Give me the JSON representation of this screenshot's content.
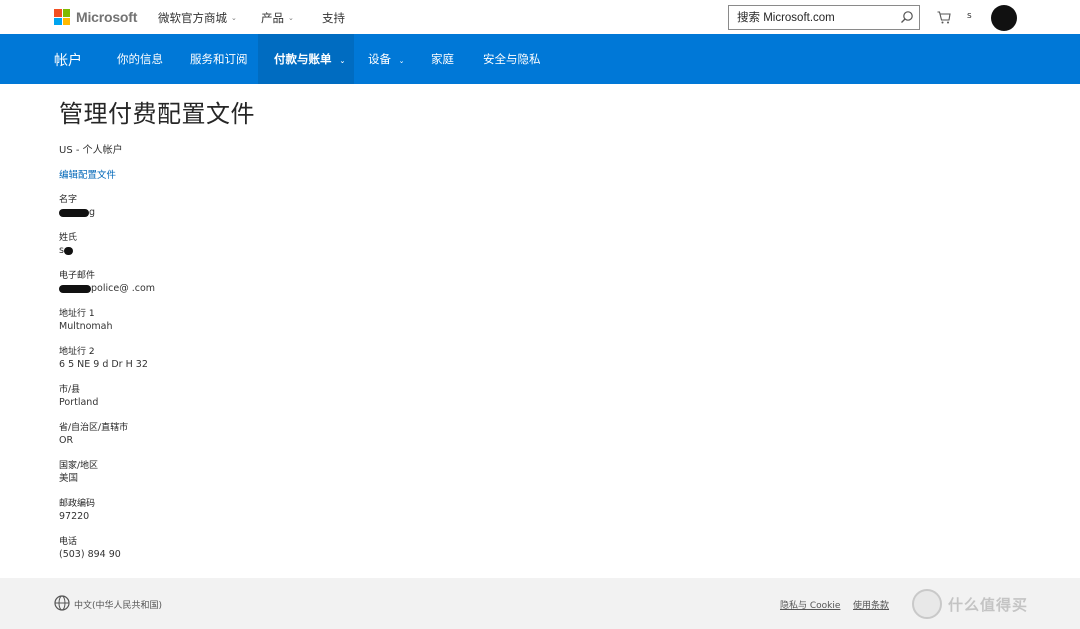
{
  "header": {
    "logo_text": "Microsoft",
    "logo_colors": [
      "#f25022",
      "#7fba00",
      "#00a4ef",
      "#ffb900"
    ],
    "nav": [
      {
        "label": "微软官方商城",
        "has_dropdown": true
      },
      {
        "label": "产品",
        "has_dropdown": true
      },
      {
        "label": "支持",
        "has_dropdown": false
      }
    ],
    "search_placeholder": "搜索 Microsoft.com",
    "user_initial": "s"
  },
  "account_nav": {
    "brand": "帐户",
    "items": [
      {
        "label": "你的信息",
        "has_dropdown": false,
        "active": false
      },
      {
        "label": "服务和订阅",
        "has_dropdown": false,
        "active": false
      },
      {
        "label": "付款与账单",
        "has_dropdown": true,
        "active": true
      },
      {
        "label": "设备",
        "has_dropdown": true,
        "active": false
      },
      {
        "label": "家庭",
        "has_dropdown": false,
        "active": false
      },
      {
        "label": "安全与隐私",
        "has_dropdown": false,
        "active": false
      }
    ],
    "color": "#0078d7"
  },
  "main": {
    "title": "管理付费配置文件",
    "account_type": "US - 个人帐户",
    "edit_link": "编辑配置文件",
    "fields": [
      {
        "label": "名字",
        "value": "g"
      },
      {
        "label": "姓氏",
        "value": "s"
      },
      {
        "label": "电子邮件",
        "value": "police@ .com"
      },
      {
        "label": "地址行 1",
        "value": "Multnomah"
      },
      {
        "label": "地址行 2",
        "value": "6 5 NE 9 d Dr H 32"
      },
      {
        "label": "市/县",
        "value": "Portland"
      },
      {
        "label": "省/自治区/直辖市",
        "value": "OR"
      },
      {
        "label": "国家/地区",
        "value": "美国"
      },
      {
        "label": "邮政编码",
        "value": "97220"
      },
      {
        "label": "电话",
        "value": "(503) 894 90"
      }
    ]
  },
  "footer": {
    "locale": "中文(中华人民共和国)",
    "links": [
      "隐私与 Cookie",
      "使用条款"
    ],
    "watermark_text": "什么值得买"
  }
}
